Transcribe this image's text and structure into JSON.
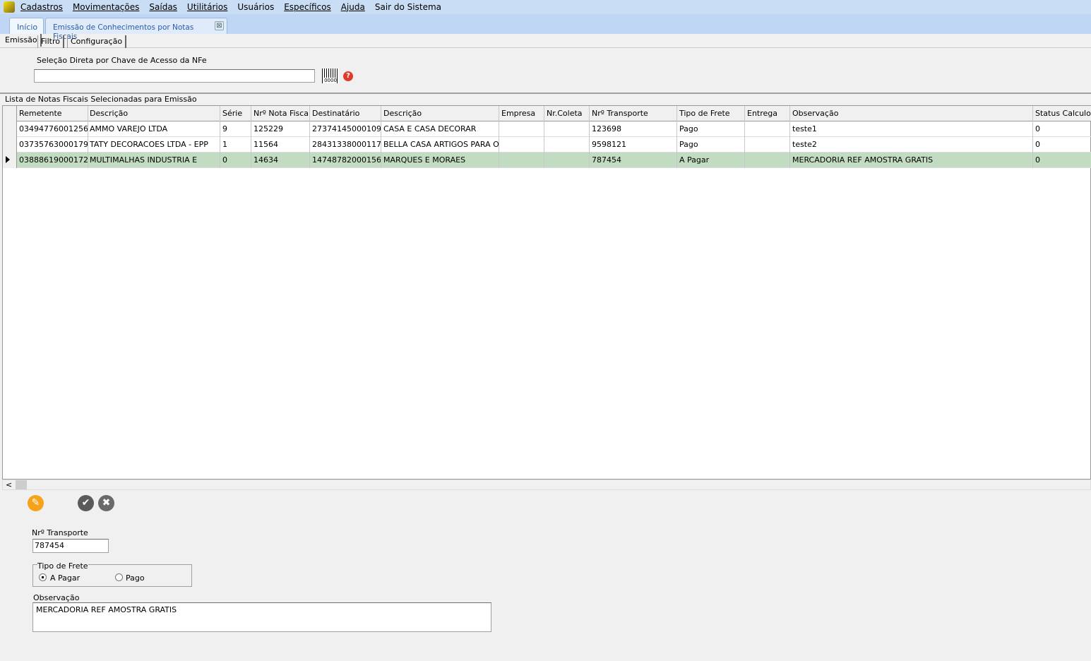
{
  "menu": [
    "Cadastros",
    "Movimentações",
    "Saídas",
    "Utilitários",
    "Usuários",
    "Específicos",
    "Ajuda",
    "Sair do Sistema"
  ],
  "doc_tabs": {
    "home": "Início",
    "active": "Emissão de Conhecimentos por Notas Fiscais",
    "close": "⊠"
  },
  "sub_tabs": [
    "Emissão",
    "Filtro",
    "Configuração"
  ],
  "nfe": {
    "label": "Seleção Direta por Chave de Acesso da NFe",
    "value": "",
    "barcode": "0000",
    "help": "?"
  },
  "grid": {
    "title": "Lista de Notas Fiscais Selecionadas para Emissão",
    "columns": [
      "Remetente",
      "Descrição",
      "Série",
      "Nrº Nota Fiscal",
      "Destinatário",
      "Descrição",
      "Empresa",
      "Nr.Coleta",
      "Nrº Transporte",
      "Tipo de Frete",
      "Entrega",
      "Observação",
      "Status Calculo"
    ],
    "rows": [
      [
        "03494776001256",
        "AMMO VAREJO LTDA",
        "9",
        "125229",
        "27374145000109",
        "CASA E CASA DECORAR",
        "",
        "",
        "123698",
        "Pago",
        "",
        "teste1",
        "0"
      ],
      [
        "03735763000179",
        "TATY DECORACOES LTDA - EPP",
        "1",
        "11564",
        "28431338000117",
        "BELLA CASA ARTIGOS PARA O",
        "",
        "",
        "9598121",
        "Pago",
        "",
        "teste2",
        "0"
      ],
      [
        "03888619000172",
        "MULTIMALHAS INDUSTRIA E",
        "0",
        "14634",
        "14748782000156",
        "MARQUES E MORAES",
        "",
        "",
        "787454",
        "A Pagar",
        "",
        "MERCADORIA REF AMOSTRA GRATIS",
        "0"
      ]
    ],
    "selected_row": 2,
    "scroll_left": "<"
  },
  "form": {
    "transporte_label": "Nrº Transporte",
    "transporte_value": "787454",
    "frete_label": "Tipo de Frete",
    "frete_options": [
      "A Pagar",
      "Pago"
    ],
    "frete_selected": "A Pagar",
    "obs_label": "Observação",
    "obs_value": "MERCADORIA REF AMOSTRA GRATIS"
  },
  "actions": {
    "edit": "✎",
    "confirm": "✔",
    "cancel": "✖"
  },
  "colors": {
    "selected_row": "#c2dcc2",
    "edit": "#f7a21b",
    "action": "#5a5a5a"
  }
}
